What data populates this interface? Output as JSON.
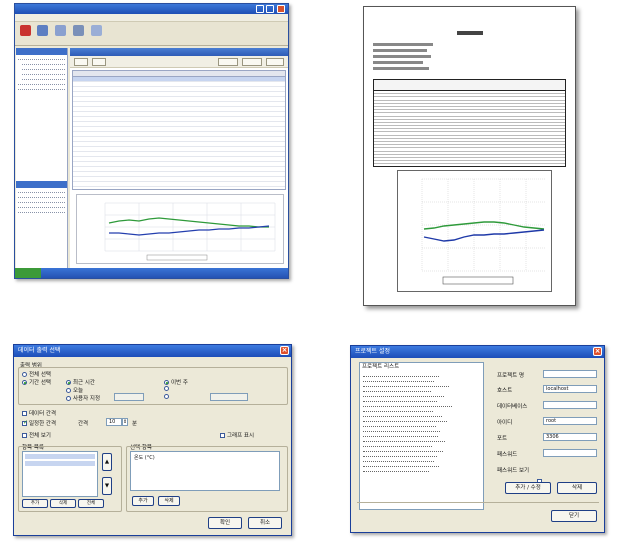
{
  "dialog_data_select": {
    "title": "데이터 출력 선택",
    "close": "×",
    "section_period": "출력 범위",
    "opt_all": "전체 선택",
    "opt_range": "기간 선택",
    "opt_latest_hour": "최근 시간",
    "opt_today": "오늘",
    "opt_this_week": "이번 주",
    "opt_custom": "사용자 지정",
    "section_interval": "데이터 간격",
    "chk_interval": "일정한 간격",
    "interval_label": "간격",
    "interval_value": "10",
    "interval_unit": "분",
    "chk_show_all": "전체 보기",
    "chk_graph": "그래프 표시",
    "list_left_header": "항목 목록",
    "list_right_header": "선택 항목",
    "list_right_item": "온도 (°C)",
    "btn_up": "▲",
    "btn_down": "▼",
    "btn_add_item": "추가",
    "btn_remove_item": "삭제",
    "btn_small_add": "추가",
    "btn_small_delete": "삭제",
    "btn_all": "전체",
    "btn_ok": "확인",
    "btn_cancel": "취소"
  },
  "dialog_project": {
    "title": "프로젝트 설정",
    "close": "×",
    "list_header": "프로젝트 리스트",
    "field_project_name": "프로젝트 명",
    "field_host": "호스트",
    "field_database": "데이터베이스",
    "field_id": "아이디",
    "field_port": "포트",
    "field_password": "패스워드",
    "chk_show_password": "패스워드 보기",
    "host_value": "localhost",
    "id_value": "root",
    "port_value": "3306",
    "btn_add_edit": "추가 / 수정",
    "btn_delete": "삭제",
    "btn_close": "닫기"
  }
}
